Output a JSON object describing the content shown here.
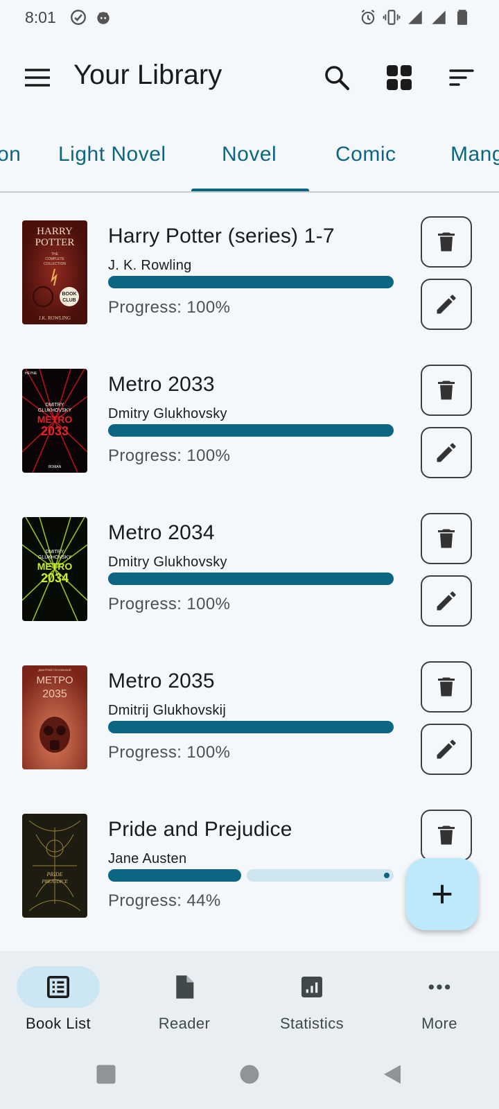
{
  "status_bar": {
    "time": "8:01",
    "left_icons": [
      "check-circle-icon",
      "android-icon"
    ],
    "right_icons": [
      "alarm-icon",
      "vibrate-icon",
      "signal-icon",
      "signal-icon",
      "battery-icon"
    ]
  },
  "app_bar": {
    "title": "Your Library",
    "icons": [
      "menu-icon",
      "search-icon",
      "grid-view-icon",
      "sort-icon"
    ]
  },
  "tabs": [
    {
      "label": "on",
      "active": false
    },
    {
      "label": "Light Novel",
      "active": false
    },
    {
      "label": "Novel",
      "active": true
    },
    {
      "label": "Comic",
      "active": false
    },
    {
      "label": "Mang",
      "active": false
    }
  ],
  "books": [
    {
      "title": "Harry Potter (series) 1-7",
      "author": "J. K. Rowling",
      "progress": 1.0,
      "progress_text": "Progress: 100%",
      "cover": {
        "line1": "HARRY",
        "line2": "POTTER",
        "sub": "COMPLETE COLLECTION",
        "footer": "J.K. ROWLING",
        "badge1": "BOOK",
        "badge2": "CLUB"
      }
    },
    {
      "title": "Metro 2033",
      "author": "Dmitry Glukhovsky",
      "progress": 1.0,
      "progress_text": "Progress: 100%",
      "cover": {
        "top": "HEYNE",
        "author1": "DMITRY",
        "author2": "GLUKHOVSKY",
        "line1": "METRO",
        "line2": "2033",
        "footer": "ROMAN"
      }
    },
    {
      "title": "Metro 2034",
      "author": "Dmitry Glukhovsky",
      "progress": 1.0,
      "progress_text": "Progress: 100%",
      "cover": {
        "author1": "DMITRY",
        "author2": "GLUKHOVSKY",
        "line1": "METRO",
        "line2": "2034"
      }
    },
    {
      "title": "Metro 2035",
      "author": "Dmitrij Glukhovskij",
      "progress": 1.0,
      "progress_text": "Progress: 100%",
      "cover": {
        "author1": "ДМИТРИЙ ГЛУХОВСКИЙ",
        "line1": "МЕТРО",
        "line2": "2035"
      }
    },
    {
      "title": "Pride and Prejudice",
      "author": "Jane Austen",
      "progress": 0.44,
      "progress_text": "Progress: 44%",
      "cover": {
        "line1": "PRIDE",
        "line2": "PREJUDICE"
      }
    }
  ],
  "row_actions": {
    "delete_icon": "delete-icon",
    "edit_icon": "edit-icon"
  },
  "fab": {
    "icon": "plus-icon"
  },
  "bottom_nav": [
    {
      "label": "Book List",
      "icon": "list-icon",
      "active": true
    },
    {
      "label": "Reader",
      "icon": "document-icon",
      "active": false
    },
    {
      "label": "Statistics",
      "icon": "chart-icon",
      "active": false
    },
    {
      "label": "More",
      "icon": "more-horiz-icon",
      "active": false
    }
  ],
  "system_nav": [
    "recents-icon",
    "home-icon",
    "back-icon"
  ],
  "colors": {
    "accent": "#0c6681",
    "background": "#f4f8fb",
    "fab": "#bde9fb",
    "nav_bg": "#e8eef2",
    "nav_pill": "#cde6f3"
  }
}
